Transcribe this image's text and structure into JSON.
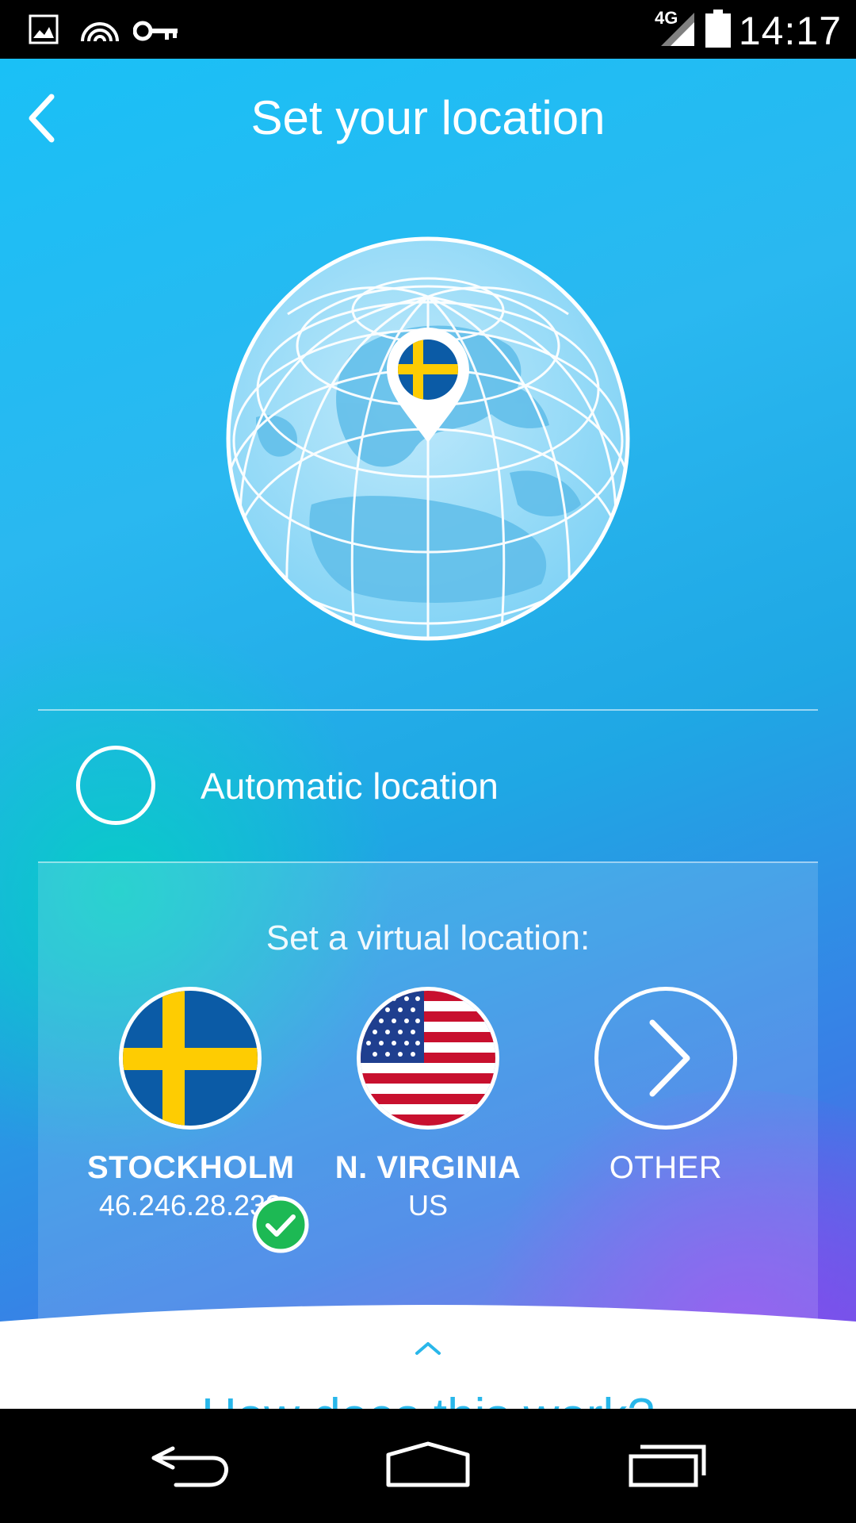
{
  "status_bar": {
    "network": "4G",
    "time": "14:17",
    "icons": [
      "image-icon",
      "broadcast-icon",
      "key-icon",
      "signal-icon",
      "battery-icon"
    ]
  },
  "header": {
    "title": "Set your location",
    "back_icon": "chevron-left-icon"
  },
  "automatic": {
    "label": "Automatic location",
    "selected": false
  },
  "virtual": {
    "title": "Set a virtual location:",
    "locations": [
      {
        "name": "STOCKHOLM",
        "sub": "46.246.28.233",
        "flag": "sweden-flag",
        "selected": true
      },
      {
        "name": "N. VIRGINIA",
        "sub": "US",
        "flag": "usa-flag",
        "selected": false
      },
      {
        "name": "OTHER",
        "sub": "",
        "flag": "chevron-right-icon",
        "selected": false
      }
    ]
  },
  "help": {
    "label": "How does this work?"
  },
  "colors": {
    "accent": "#29b7ea",
    "sweden_blue": "#0b5ba6",
    "sweden_yellow": "#fecc02",
    "check_green": "#1db954"
  }
}
